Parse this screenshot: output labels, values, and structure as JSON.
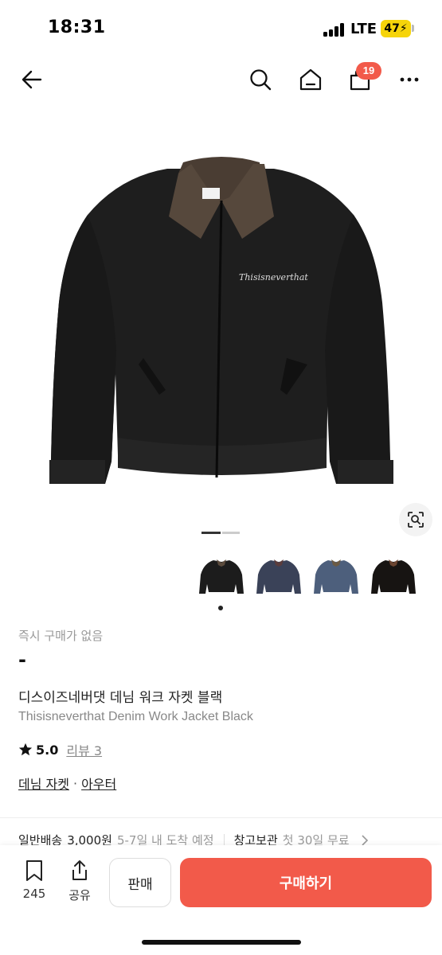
{
  "status_bar": {
    "time": "18:31",
    "carrier": "LTE",
    "battery": "47"
  },
  "nav": {
    "back_icon": "back-arrow-icon",
    "search_icon": "search-icon",
    "home_icon": "home-icon",
    "cart_icon": "shopping-bag-icon",
    "cart_count": "19",
    "more_icon": "more-dots-icon"
  },
  "product": {
    "image_icon": "denim-jacket-photo",
    "embroidery": "Thisisneverthat",
    "lens_icon": "image-search-icon",
    "thumbnails": [
      {
        "name": "thumbnail-black",
        "color": "#1c1c1c"
      },
      {
        "name": "thumbnail-navy",
        "color": "#3a4258"
      },
      {
        "name": "thumbnail-blue",
        "color": "#4d5f7c"
      },
      {
        "name": "thumbnail-dark",
        "color": "#171412"
      }
    ],
    "stock_status": "즉시 구매가 없음",
    "price": "-",
    "name_ko": "디스이즈네버댓 데님 워크 자켓 블랙",
    "name_en": "Thisisneverthat Denim Work Jacket Black",
    "rating": "5.0",
    "reviews": "리뷰 3",
    "category_1": "데님 자켓",
    "category_sep": "·",
    "category_2": "아우터"
  },
  "shipping": {
    "label": "일반배송",
    "fee": "3,000원",
    "eta": "5-7일 내 도착 예정",
    "storage_label": "창고보관",
    "storage_text": "첫 30일 무료"
  },
  "bottom_bar": {
    "bookmark_count": "245",
    "share_label": "공유",
    "sell_label": "판매",
    "buy_label": "구매하기"
  },
  "colors": {
    "accent": "#f25a4a",
    "battery": "#f6d40a"
  }
}
